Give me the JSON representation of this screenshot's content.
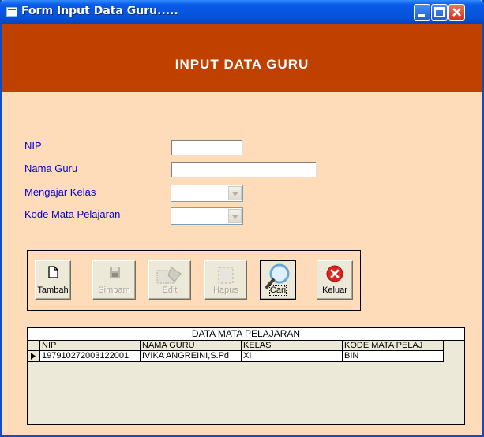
{
  "window": {
    "title": "Form Input Data Guru....."
  },
  "header": {
    "title": "INPUT DATA GURU"
  },
  "form": {
    "nip_label": "NIP",
    "nama_label": "Nama Guru",
    "kelas_label": "Mengajar Kelas",
    "kode_label": "Kode Mata Pelajaran",
    "nip_value": "",
    "nama_value": "",
    "kelas_value": "",
    "kode_value": ""
  },
  "toolbar": {
    "buttons": [
      {
        "label": "Tambah",
        "enabled": true,
        "icon": "new-document-icon"
      },
      {
        "label": "Simpam",
        "enabled": false,
        "icon": "floppy-disk-icon"
      },
      {
        "label": "Edit",
        "enabled": false,
        "icon": "edit-icon"
      },
      {
        "label": "Hapus",
        "enabled": false,
        "icon": "delete-icon"
      },
      {
        "label": "Cari",
        "enabled": true,
        "icon": "magnifier-icon"
      },
      {
        "label": "Keluar",
        "enabled": true,
        "icon": "exit-icon"
      }
    ]
  },
  "grid": {
    "caption": "DATA MATA PELAJARAN",
    "columns": [
      "NIP",
      "NAMA GURU",
      "KELAS",
      "KODE MATA PELAJ"
    ],
    "rows": [
      [
        "197910272003122001",
        "IVIKA ANGREINI,S.Pd",
        "XI",
        "BIN"
      ]
    ]
  },
  "colors": {
    "header": "#c04000",
    "form_bg": "#ffdcb9",
    "label": "#0000d0",
    "titlebar": "#0a5ae8"
  }
}
